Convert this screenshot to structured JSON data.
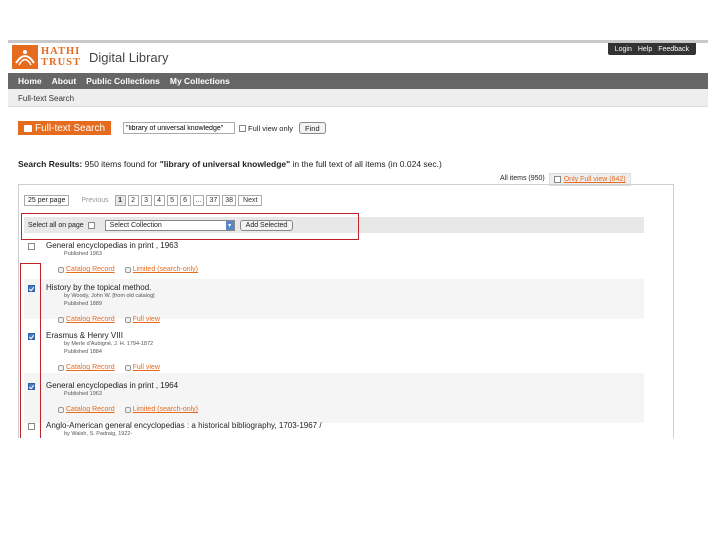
{
  "header": {
    "logo_line1": "HATHI",
    "logo_line2": "TRUST",
    "logo_tagline": "Digital Library",
    "util_links": [
      "Login",
      "Help",
      "Feedback"
    ]
  },
  "nav": {
    "items": [
      "Home",
      "About",
      "Public Collections",
      "My Collections"
    ]
  },
  "breadcrumb": "Full-text Search",
  "search": {
    "button_label": "Full-text Search",
    "query": "\"library of universal knowledge\"",
    "full_view_label": "Full view only",
    "find_label": "Find"
  },
  "results": {
    "prefix": "Search Results:",
    "count_text": "950 items found for",
    "query": "\"library of universal knowledge\"",
    "suffix": "in the full text of all items (in 0.024 sec.)"
  },
  "tabs": {
    "all": "All items (950)",
    "full": "Only Full view (642)"
  },
  "pager": {
    "per_page": "25 per page",
    "prev": "Previous",
    "pages": [
      "1",
      "2",
      "3",
      "4",
      "5",
      "6",
      "...",
      "37",
      "38"
    ],
    "next": "Next"
  },
  "select_bar": {
    "select_all": "Select all on page",
    "collection": "Select Collection",
    "add": "Add Selected"
  },
  "items": [
    {
      "title": "General encyclopedias in print , 1963",
      "meta": [
        "Published 1963"
      ],
      "checked": false,
      "links": [
        "Catalog Record",
        "Limited (search-only)"
      ]
    },
    {
      "title": "History by the topical method.",
      "meta": [
        "by Woody, John W. [from old catalog]",
        "Published 1889"
      ],
      "checked": true,
      "links": [
        "Catalog Record",
        "Full view"
      ]
    },
    {
      "title": "Erasmus & Henry VIII",
      "meta": [
        "by Merle d'Aubigné, J. H. 1794-1872",
        "Published 1884"
      ],
      "checked": true,
      "links": [
        "Catalog Record",
        "Full view"
      ]
    },
    {
      "title": "General encyclopedias in print , 1964",
      "meta": [
        "Published 1963"
      ],
      "checked": true,
      "links": [
        "Catalog Record",
        "Limited (search-only)"
      ]
    },
    {
      "title": "Anglo-American general encyclopedias : a historical bibliography, 1703-1967 /",
      "meta": [
        "by Walsh, S. Padraig, 1922-"
      ],
      "checked": false,
      "links": []
    }
  ],
  "colors": {
    "brand_orange": "#e56c1f",
    "nav_gray": "#666666",
    "highlight_red": "#c0242b"
  }
}
